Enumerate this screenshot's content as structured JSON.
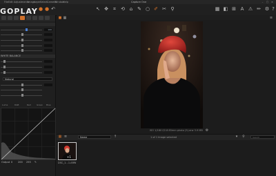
{
  "menu": {
    "items": [
      "File",
      "Edit",
      "Adjustments",
      "Image",
      "Layer",
      "Select",
      "Camera",
      "Window",
      "Help"
    ],
    "app_title": "Capture One"
  },
  "logo": "GOPLAY",
  "tools": {
    "section_header_1": "",
    "section_header_2": "WHITE BALANCE",
    "values": [
      "100",
      "",
      "",
      "",
      "",
      "",
      "",
      "",
      ""
    ],
    "dropdown_label": "Natural",
    "curve_tabs": [
      "Luma",
      "RGB",
      "Red",
      "Green",
      "Blue"
    ],
    "hist_footer": [
      "0",
      "200",
      "255"
    ],
    "hist_output_label": "Output"
  },
  "viewer": {
    "title": "",
    "caption": "ISO 1/160 f/2.8 85mm photo (5).arw 3.9 MB"
  },
  "browser": {
    "dropdown_value": "Name",
    "selection_count": "1 of 1 Image selected",
    "search_placeholder": "Search",
    "thumb_badge": "+1",
    "thumb_label": "DSC_1…1.ARW"
  },
  "colors": {
    "accent_blue": "#4a7fd4",
    "tab_orange": "#d0702a",
    "background": "#1c1c1c"
  },
  "icons": [
    "menu-icon",
    "cursor-icon",
    "crop-icon",
    "rotate-icon",
    "keystone-icon",
    "circle-icon",
    "mask-icon",
    "brush-icon",
    "eraser-icon",
    "picker-icon",
    "grid-icon",
    "compare-icon",
    "text-icon",
    "brush2-icon",
    "settings-icon",
    "help-icon"
  ]
}
